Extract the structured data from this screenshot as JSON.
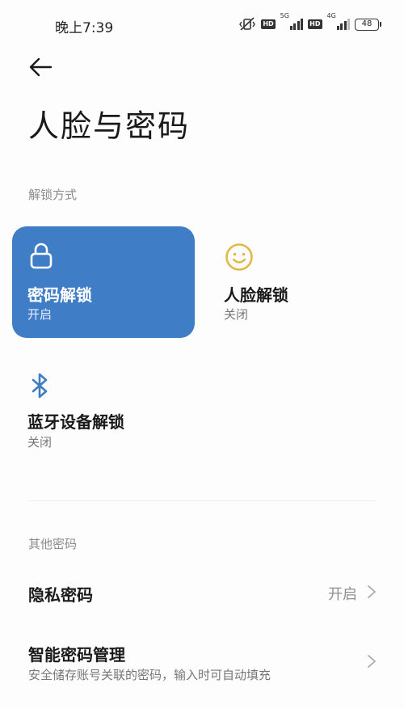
{
  "status_bar": {
    "time": "晚上7:39",
    "sim1_hd": "HD",
    "sim1_network": "5G",
    "sim2_hd": "HD",
    "sim2_network": "4G",
    "battery": "48"
  },
  "header": {
    "title": "人脸与密码"
  },
  "unlock_section": {
    "header": "解锁方式",
    "cards": [
      {
        "title": "密码解锁",
        "status": "开启",
        "icon": "lock-icon",
        "selected": true
      },
      {
        "title": "人脸解锁",
        "status": "关闭",
        "icon": "smiley-face-icon",
        "selected": false
      },
      {
        "title": "蓝牙设备解锁",
        "status": "关闭",
        "icon": "bluetooth-icon",
        "selected": false
      }
    ]
  },
  "other_section": {
    "header": "其他密码",
    "items": [
      {
        "title": "隐私密码",
        "value": "开启"
      },
      {
        "title": "智能密码管理",
        "subtitle": "安全储存账号关联的密码，输入时可自动填充"
      }
    ]
  },
  "colors": {
    "accent": "#3f7dc6",
    "face_icon": "#e3b84b",
    "bluetooth_icon": "#3f7dc6",
    "background": "#fdfdfd"
  }
}
